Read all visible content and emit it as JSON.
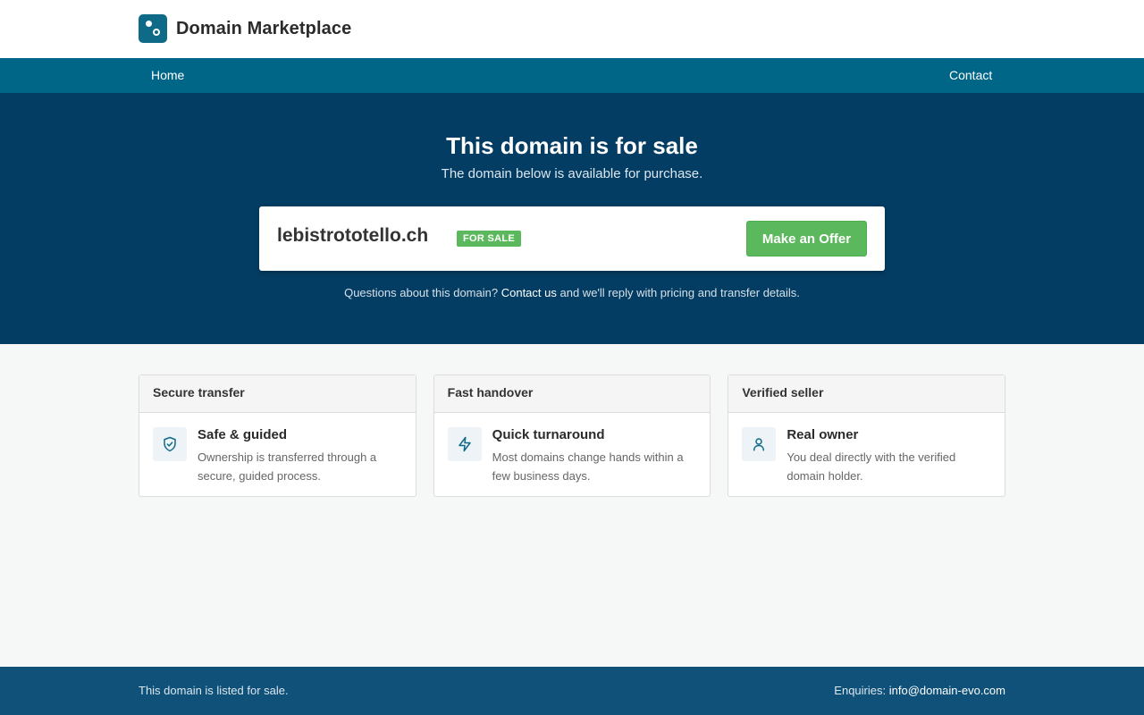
{
  "brand": {
    "name": "Domain Marketplace",
    "logo_icon": "marketplace-logo-icon"
  },
  "nav": {
    "home": "Home",
    "contact": "Contact"
  },
  "hero": {
    "title": "This domain is for sale",
    "subtitle": "The domain below is available for purchase.",
    "domain": "lebistrototello.ch",
    "badge": "FOR SALE",
    "offer_button": "Make an Offer",
    "questions_prefix": "Questions about this domain?",
    "questions_link": "Contact us",
    "questions_suffix": "and we'll reply with pricing and transfer details."
  },
  "features": [
    {
      "header": "Secure transfer",
      "icon": "shield-check-icon",
      "title": "Safe & guided",
      "desc": "Ownership is transferred through a secure, guided process."
    },
    {
      "header": "Fast handover",
      "icon": "lightning-icon",
      "title": "Quick turnaround",
      "desc": "Most domains change hands within a few business days."
    },
    {
      "header": "Verified seller",
      "icon": "user-icon",
      "title": "Real owner",
      "desc": "You deal directly with the verified domain holder."
    }
  ],
  "footer": {
    "left": "This domain is listed for sale.",
    "enquiries_label": "Enquiries:",
    "email": "info@domain-evo.com"
  },
  "colors": {
    "accent": "#006687",
    "hero_bg": "#043d63",
    "footer_bg": "#0f5179",
    "success": "#5cb85c"
  }
}
